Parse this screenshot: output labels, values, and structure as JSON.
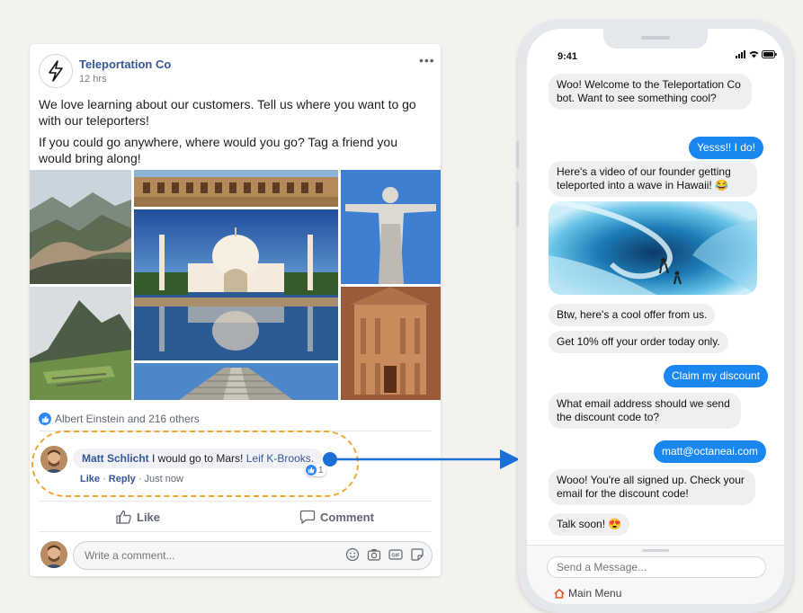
{
  "post": {
    "page_name": "Teleportation Co",
    "time": "12 hrs",
    "more_label": "•••",
    "text_1": "We love learning about our customers. Tell us where you want to go with our teleporters!",
    "text_2": "If you could go anywhere, where would you go? Tag a friend you would bring along!",
    "photos": [
      "great-wall",
      "colosseum",
      "taj-mahal",
      "christ-the-redeemer",
      "machu-picchu",
      "petra",
      "chichen-itza"
    ],
    "reactions_text": "Albert Einstein and 216 others",
    "comment": {
      "author": "Matt Schlicht",
      "text": " I would go to Mars! ",
      "tag": "Leif K-Brooks",
      "tag_suffix": ".",
      "like_label": "Like",
      "sep": " · ",
      "reply_label": "Reply",
      "time": "Just now",
      "like_count": "1"
    },
    "like_button": "Like",
    "comment_button": "Comment",
    "write_placeholder": "Write a comment...",
    "composer_icons": [
      "emoji-icon",
      "camera-icon",
      "gif-icon",
      "sticker-icon"
    ]
  },
  "colors": {
    "accent_blue": "#1a86f0",
    "highlight_orange": "#f0a830",
    "fb_link": "#365899"
  },
  "phone": {
    "time": "9:41",
    "messages": [
      {
        "from": "bot",
        "text": "Woo! Welcome to the Teleportation Co bot. Want to see something cool?"
      },
      {
        "from": "user",
        "text": "Yesss!! I do!"
      },
      {
        "from": "bot",
        "text": "Here's a video of our founder getting teleported into a wave in Hawaii! 😂"
      },
      {
        "from": "bot",
        "text": "Btw, here's a cool offer from us."
      },
      {
        "from": "bot",
        "text": "Get 10% off your order today only."
      },
      {
        "from": "user",
        "text": "Claim my discount"
      },
      {
        "from": "bot",
        "text": "What email address should we send the discount code to?"
      },
      {
        "from": "user",
        "text": "matt@octaneai.com"
      },
      {
        "from": "bot",
        "text": "Wooo! You're all signed up. Check your email for the discount code!"
      },
      {
        "from": "bot",
        "text": "Talk soon! 😍"
      }
    ],
    "video": "wave-surfer",
    "input_placeholder": "Send a Message...",
    "main_menu": "Main Menu"
  }
}
